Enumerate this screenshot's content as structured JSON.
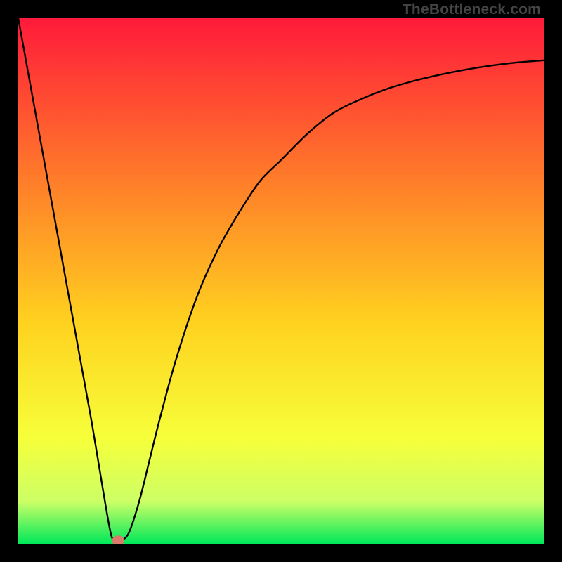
{
  "watermark": "TheBottleneck.com",
  "colors": {
    "bg": "#000000",
    "curve": "#000000",
    "marker_fill": "#d97a6a",
    "marker_stroke": "#d97a6a",
    "gradient_top": "#ff1a3a",
    "gradient_mid_upper": "#ff7a2a",
    "gradient_mid": "#ffd21f",
    "gradient_mid_lower": "#f6ff3a",
    "gradient_band": "#ccff66",
    "gradient_bottom": "#00e85a"
  },
  "chart_data": {
    "type": "line",
    "title": "",
    "xlabel": "",
    "ylabel": "",
    "xlim": [
      0,
      100
    ],
    "ylim": [
      0,
      100
    ],
    "grid": false,
    "legend": false,
    "series": [
      {
        "name": "bottleneck-curve",
        "x": [
          0,
          2,
          4,
          6,
          8,
          10,
          12,
          14,
          16,
          17.6,
          18.5,
          19.4,
          21,
          23,
          25,
          27,
          30,
          34,
          38,
          42,
          46,
          50,
          55,
          60,
          65,
          70,
          75,
          80,
          85,
          90,
          95,
          100
        ],
        "y": [
          100,
          89,
          78,
          67,
          56,
          45,
          34,
          23,
          11,
          2,
          0.6,
          0.6,
          2,
          8,
          16,
          24,
          35,
          47,
          56,
          63,
          69,
          73,
          78,
          82,
          84.5,
          86.5,
          88,
          89.2,
          90.2,
          91,
          91.6,
          92
        ]
      }
    ],
    "marker": {
      "x": 19,
      "y": 0.6,
      "rx": 1.1,
      "ry": 0.9
    },
    "background_gradient": {
      "direction": "vertical",
      "stops": [
        {
          "offset": 0.0,
          "color": "#ff1a3a"
        },
        {
          "offset": 0.3,
          "color": "#ff7a2a"
        },
        {
          "offset": 0.58,
          "color": "#ffd21f"
        },
        {
          "offset": 0.8,
          "color": "#f6ff3a"
        },
        {
          "offset": 0.92,
          "color": "#ccff66"
        },
        {
          "offset": 1.0,
          "color": "#00e85a"
        }
      ]
    }
  }
}
